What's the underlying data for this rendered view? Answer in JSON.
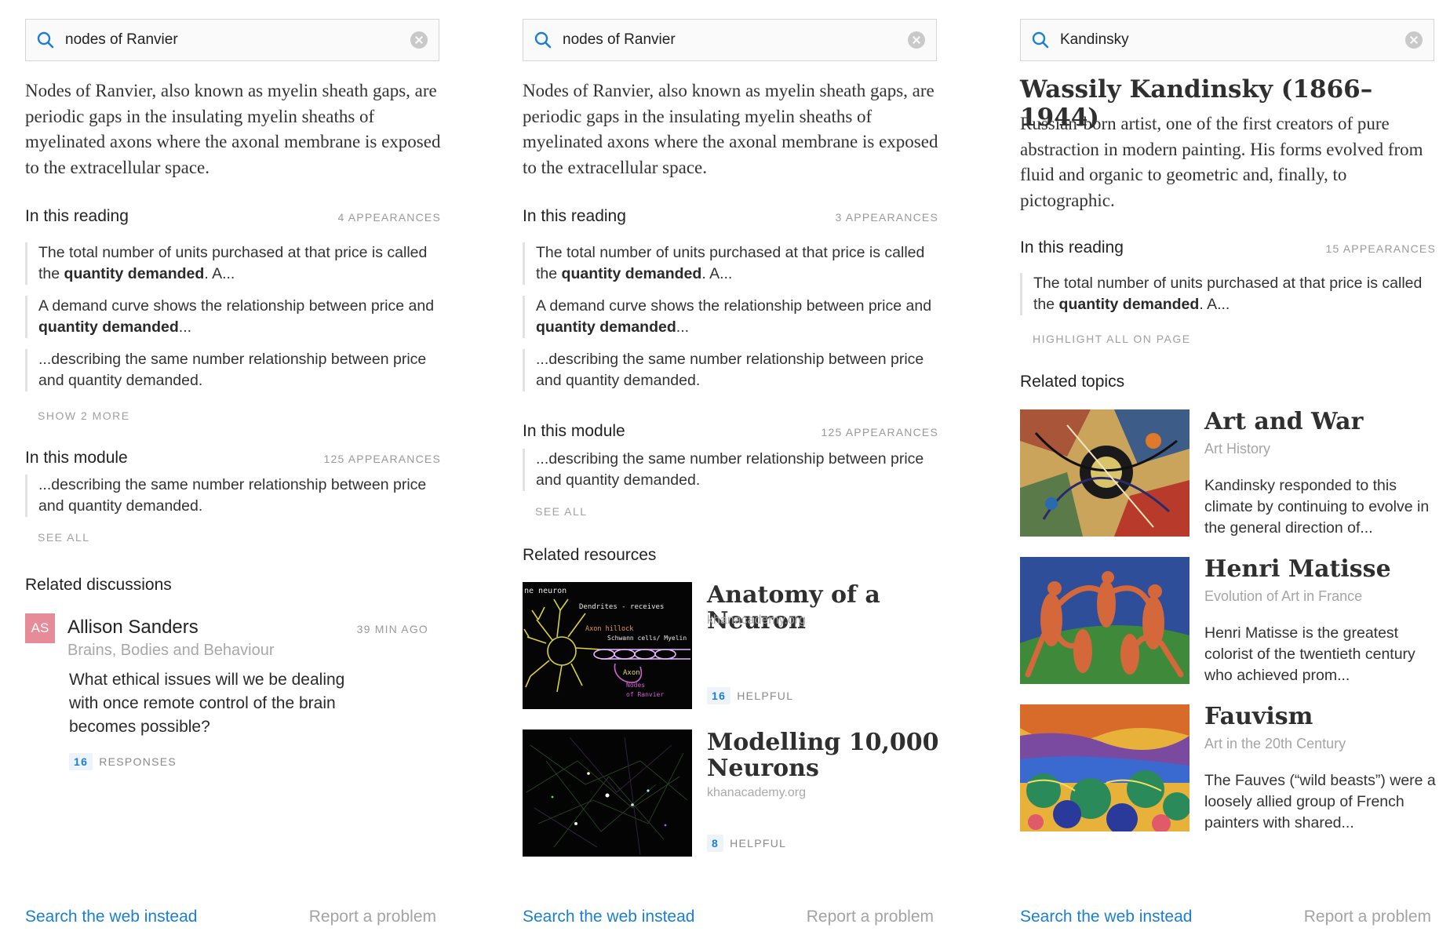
{
  "panels": [
    {
      "search": {
        "value": "nodes of Ranvier"
      },
      "definition": "Nodes of Ranvier, also known as myelin sheath gaps, are periodic gaps in the insulating myelin sheaths of myelinated axons where the axonal membrane is exposed to the extracellular space.",
      "reading": {
        "title": "In this reading",
        "count": "4 APPEARANCES",
        "quotes": [
          {
            "before": "The total number of units purchased at that price is called the ",
            "bold": "quantity demanded",
            "after": ". A..."
          },
          {
            "before": "A demand curve shows the relationship between price and ",
            "bold": "quantity demanded",
            "after": "..."
          },
          {
            "before": "...describing the same number relationship between price and quantity demanded.",
            "bold": "",
            "after": ""
          }
        ],
        "more": "SHOW 2 MORE"
      },
      "module": {
        "title": "In this module",
        "count": "125 APPEARANCES",
        "quote": "...describing the same number relationship between price and quantity demanded.",
        "more": "SEE ALL"
      },
      "discussions": {
        "title": "Related discussions",
        "item": {
          "initials": "AS",
          "name": "Allison Sanders",
          "time": "39 MIN AGO",
          "group": "Brains, Bodies and Behaviour",
          "question": "What ethical issues will we be dealing with once remote control of the brain becomes possible?",
          "responses_count": "16",
          "responses_label": "RESPONSES"
        }
      },
      "footer": {
        "search_web": "Search the web instead",
        "report": "Report a problem"
      }
    },
    {
      "search": {
        "value": "nodes of Ranvier"
      },
      "definition": "Nodes of Ranvier, also known as myelin sheath gaps, are periodic gaps in the insulating myelin sheaths of myelinated axons where the axonal membrane is exposed to the extracellular space.",
      "reading": {
        "title": "In this reading",
        "count": "3 APPEARANCES",
        "quotes": [
          {
            "before": "The total number of units purchased at that price is called the ",
            "bold": "quantity demanded",
            "after": ". A..."
          },
          {
            "before": "A demand curve shows the relationship between price and ",
            "bold": "quantity demanded",
            "after": "..."
          },
          {
            "before": "...describing the same number relationship between price and quantity demanded.",
            "bold": "",
            "after": ""
          }
        ]
      },
      "module": {
        "title": "In this module",
        "count": "125 APPEARANCES",
        "quote": "...describing the same number relationship between price and quantity demanded.",
        "more": "SEE ALL"
      },
      "resources": {
        "title": "Related resources",
        "items": [
          {
            "title": "Anatomy of a Neuron",
            "source": "khanacademy.org",
            "count": "16",
            "label": "HELPFUL",
            "thumb_text": [
              "ne  neuron",
              "Dendrites - receives",
              "Axon hillock",
              "Schwann cells/ Myelin",
              "Axon",
              "Nodes",
              "of Ranvier"
            ]
          },
          {
            "title": "Modelling 10,000 Neurons",
            "source": "khanacademy.org",
            "count": "8",
            "label": "HELPFUL"
          }
        ]
      },
      "footer": {
        "search_web": "Search the web instead",
        "report": "Report a problem"
      }
    },
    {
      "search": {
        "value": "Kandinsky"
      },
      "heading": "Wassily Kandinsky (1866–1944)",
      "definition": "Russian-born artist, one of the first creators of pure abstraction in modern painting. His forms evolved from fluid and organic to geometric and, finally, to pictographic.",
      "reading": {
        "title": "In this reading",
        "count": "15 APPEARANCES",
        "quote": {
          "before": "The total number of units purchased at that price is called the ",
          "bold": "quantity demanded",
          "after": ". A..."
        },
        "more": "HIGHLIGHT ALL ON PAGE"
      },
      "topics": {
        "title": "Related topics",
        "items": [
          {
            "title": "Art and War",
            "subtitle": "Art History",
            "desc": "Kandinsky responded to this climate by continuing to evolve in the general direction of..."
          },
          {
            "title": "Henri Matisse",
            "subtitle": "Evolution of Art in France",
            "desc": "Henri Matisse is the greatest colorist of the twentieth century who achieved prom..."
          },
          {
            "title": "Fauvism",
            "subtitle": "Art in the 20th Century",
            "desc": "The Fauves (“wild beasts”) were a loosely allied group of French painters with shared..."
          }
        ]
      },
      "footer": {
        "search_web": "Search the web instead",
        "report": "Report a problem"
      }
    }
  ],
  "colors": {
    "accent": "#1a7fd4",
    "avatar_bg": "#e58c98",
    "muted": "#a0a0a0"
  },
  "icons": {
    "search": "search-icon",
    "clear": "clear-icon"
  }
}
